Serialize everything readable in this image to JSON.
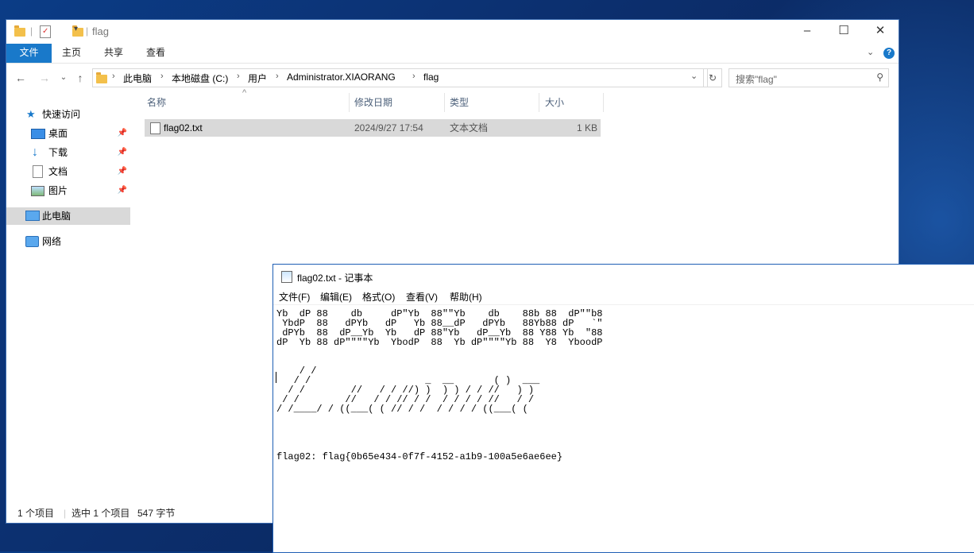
{
  "explorer": {
    "title": "flag",
    "ribbon_tabs": [
      "文件",
      "主页",
      "共享",
      "查看"
    ],
    "breadcrumb": [
      "此电脑",
      "本地磁盘 (C:)",
      "用户",
      "Administrator.XIAORANG",
      "flag"
    ],
    "search_placeholder": "搜索\"flag\"",
    "sidebar": {
      "quick_access": "快速访问",
      "pinned": [
        "桌面",
        "下载",
        "文档",
        "图片"
      ],
      "this_pc": "此电脑",
      "network": "网络"
    },
    "columns": [
      "名称",
      "修改日期",
      "类型",
      "大小"
    ],
    "files": [
      {
        "name": "flag02.txt",
        "modified": "2024/9/27 17:54",
        "type": "文本文档",
        "size": "1 KB"
      }
    ],
    "status": {
      "count": "1 个项目",
      "selected": "选中 1 个项目",
      "size": "547 字节"
    }
  },
  "notepad": {
    "title": "flag02.txt - 记事本",
    "menu": [
      "文件(F)",
      "编辑(E)",
      "格式(O)",
      "查看(V)",
      "帮助(H)"
    ],
    "content": "Yb  dP 88    db     dP\"Yb  88\"\"Yb    db    88b 88  dP\"\"b8\n YbdP  88   dPYb   dP   Yb 88__dP   dPYb   88Yb88 dP   `\"\n dPYb  88  dP__Yb  Yb   dP 88\"Yb   dP__Yb  88 Y88 Yb  \"88\ndP  Yb 88 dP\"\"\"\"Yb  YbodP  88  Yb dP\"\"\"\"Yb 88  Y8  YboodP\n\n\n    / /\n   / /                    _  __       ( )  ___\n  / /        //   / / //) )  ) ) / / //   ) )\n / /        //   / / // / /  / / / / //   / /\n/ /____/ / ((___( ( // / /  / / / / ((___( (\n\n\n\n\nflag02: flag{0b65e434-0f7f-4152-a1b9-100a5e6ae6ee}"
  }
}
